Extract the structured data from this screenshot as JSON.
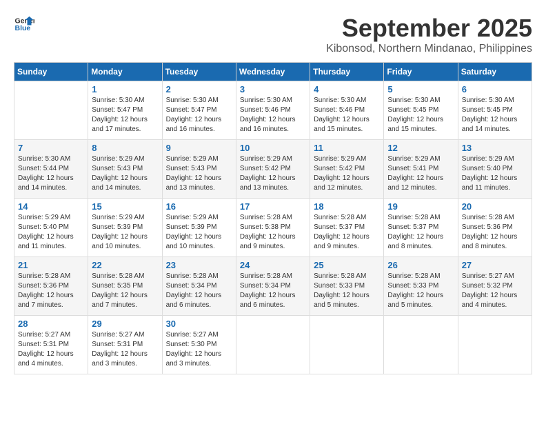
{
  "header": {
    "logo_line1": "General",
    "logo_line2": "Blue",
    "month": "September 2025",
    "location": "Kibonsod, Northern Mindanao, Philippines"
  },
  "weekdays": [
    "Sunday",
    "Monday",
    "Tuesday",
    "Wednesday",
    "Thursday",
    "Friday",
    "Saturday"
  ],
  "weeks": [
    [
      {
        "day": "",
        "sunrise": "",
        "sunset": "",
        "daylight": ""
      },
      {
        "day": "1",
        "sunrise": "Sunrise: 5:30 AM",
        "sunset": "Sunset: 5:47 PM",
        "daylight": "Daylight: 12 hours and 17 minutes."
      },
      {
        "day": "2",
        "sunrise": "Sunrise: 5:30 AM",
        "sunset": "Sunset: 5:47 PM",
        "daylight": "Daylight: 12 hours and 16 minutes."
      },
      {
        "day": "3",
        "sunrise": "Sunrise: 5:30 AM",
        "sunset": "Sunset: 5:46 PM",
        "daylight": "Daylight: 12 hours and 16 minutes."
      },
      {
        "day": "4",
        "sunrise": "Sunrise: 5:30 AM",
        "sunset": "Sunset: 5:46 PM",
        "daylight": "Daylight: 12 hours and 15 minutes."
      },
      {
        "day": "5",
        "sunrise": "Sunrise: 5:30 AM",
        "sunset": "Sunset: 5:45 PM",
        "daylight": "Daylight: 12 hours and 15 minutes."
      },
      {
        "day": "6",
        "sunrise": "Sunrise: 5:30 AM",
        "sunset": "Sunset: 5:45 PM",
        "daylight": "Daylight: 12 hours and 14 minutes."
      }
    ],
    [
      {
        "day": "7",
        "sunrise": "Sunrise: 5:30 AM",
        "sunset": "Sunset: 5:44 PM",
        "daylight": "Daylight: 12 hours and 14 minutes."
      },
      {
        "day": "8",
        "sunrise": "Sunrise: 5:29 AM",
        "sunset": "Sunset: 5:43 PM",
        "daylight": "Daylight: 12 hours and 14 minutes."
      },
      {
        "day": "9",
        "sunrise": "Sunrise: 5:29 AM",
        "sunset": "Sunset: 5:43 PM",
        "daylight": "Daylight: 12 hours and 13 minutes."
      },
      {
        "day": "10",
        "sunrise": "Sunrise: 5:29 AM",
        "sunset": "Sunset: 5:42 PM",
        "daylight": "Daylight: 12 hours and 13 minutes."
      },
      {
        "day": "11",
        "sunrise": "Sunrise: 5:29 AM",
        "sunset": "Sunset: 5:42 PM",
        "daylight": "Daylight: 12 hours and 12 minutes."
      },
      {
        "day": "12",
        "sunrise": "Sunrise: 5:29 AM",
        "sunset": "Sunset: 5:41 PM",
        "daylight": "Daylight: 12 hours and 12 minutes."
      },
      {
        "day": "13",
        "sunrise": "Sunrise: 5:29 AM",
        "sunset": "Sunset: 5:40 PM",
        "daylight": "Daylight: 12 hours and 11 minutes."
      }
    ],
    [
      {
        "day": "14",
        "sunrise": "Sunrise: 5:29 AM",
        "sunset": "Sunset: 5:40 PM",
        "daylight": "Daylight: 12 hours and 11 minutes."
      },
      {
        "day": "15",
        "sunrise": "Sunrise: 5:29 AM",
        "sunset": "Sunset: 5:39 PM",
        "daylight": "Daylight: 12 hours and 10 minutes."
      },
      {
        "day": "16",
        "sunrise": "Sunrise: 5:29 AM",
        "sunset": "Sunset: 5:39 PM",
        "daylight": "Daylight: 12 hours and 10 minutes."
      },
      {
        "day": "17",
        "sunrise": "Sunrise: 5:28 AM",
        "sunset": "Sunset: 5:38 PM",
        "daylight": "Daylight: 12 hours and 9 minutes."
      },
      {
        "day": "18",
        "sunrise": "Sunrise: 5:28 AM",
        "sunset": "Sunset: 5:37 PM",
        "daylight": "Daylight: 12 hours and 9 minutes."
      },
      {
        "day": "19",
        "sunrise": "Sunrise: 5:28 AM",
        "sunset": "Sunset: 5:37 PM",
        "daylight": "Daylight: 12 hours and 8 minutes."
      },
      {
        "day": "20",
        "sunrise": "Sunrise: 5:28 AM",
        "sunset": "Sunset: 5:36 PM",
        "daylight": "Daylight: 12 hours and 8 minutes."
      }
    ],
    [
      {
        "day": "21",
        "sunrise": "Sunrise: 5:28 AM",
        "sunset": "Sunset: 5:36 PM",
        "daylight": "Daylight: 12 hours and 7 minutes."
      },
      {
        "day": "22",
        "sunrise": "Sunrise: 5:28 AM",
        "sunset": "Sunset: 5:35 PM",
        "daylight": "Daylight: 12 hours and 7 minutes."
      },
      {
        "day": "23",
        "sunrise": "Sunrise: 5:28 AM",
        "sunset": "Sunset: 5:34 PM",
        "daylight": "Daylight: 12 hours and 6 minutes."
      },
      {
        "day": "24",
        "sunrise": "Sunrise: 5:28 AM",
        "sunset": "Sunset: 5:34 PM",
        "daylight": "Daylight: 12 hours and 6 minutes."
      },
      {
        "day": "25",
        "sunrise": "Sunrise: 5:28 AM",
        "sunset": "Sunset: 5:33 PM",
        "daylight": "Daylight: 12 hours and 5 minutes."
      },
      {
        "day": "26",
        "sunrise": "Sunrise: 5:28 AM",
        "sunset": "Sunset: 5:33 PM",
        "daylight": "Daylight: 12 hours and 5 minutes."
      },
      {
        "day": "27",
        "sunrise": "Sunrise: 5:27 AM",
        "sunset": "Sunset: 5:32 PM",
        "daylight": "Daylight: 12 hours and 4 minutes."
      }
    ],
    [
      {
        "day": "28",
        "sunrise": "Sunrise: 5:27 AM",
        "sunset": "Sunset: 5:31 PM",
        "daylight": "Daylight: 12 hours and 4 minutes."
      },
      {
        "day": "29",
        "sunrise": "Sunrise: 5:27 AM",
        "sunset": "Sunset: 5:31 PM",
        "daylight": "Daylight: 12 hours and 3 minutes."
      },
      {
        "day": "30",
        "sunrise": "Sunrise: 5:27 AM",
        "sunset": "Sunset: 5:30 PM",
        "daylight": "Daylight: 12 hours and 3 minutes."
      },
      {
        "day": "",
        "sunrise": "",
        "sunset": "",
        "daylight": ""
      },
      {
        "day": "",
        "sunrise": "",
        "sunset": "",
        "daylight": ""
      },
      {
        "day": "",
        "sunrise": "",
        "sunset": "",
        "daylight": ""
      },
      {
        "day": "",
        "sunrise": "",
        "sunset": "",
        "daylight": ""
      }
    ]
  ]
}
